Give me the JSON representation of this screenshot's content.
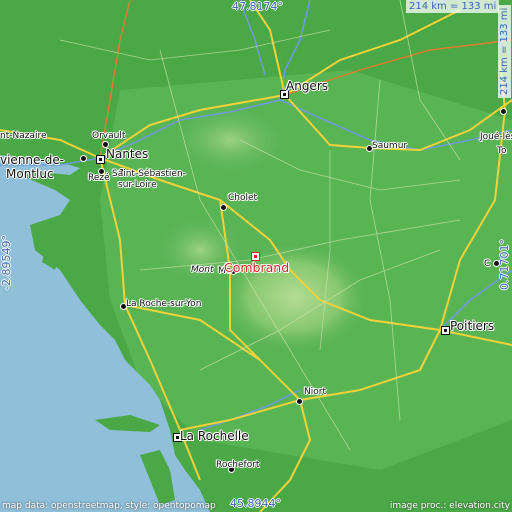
{
  "location": {
    "name": "Combrand"
  },
  "coordinates": {
    "top_lat": "47.8174°",
    "bottom_lat": "45.8944°",
    "left_lon": "-2.89549°",
    "right_lon": "0.71701°"
  },
  "scale": {
    "top": "214 km = 133 mi",
    "right": "214 km = 133 mi"
  },
  "credits": {
    "left": "map data: openstreetmap, style: opentopomap",
    "right": "image proc.: elevation.city"
  },
  "cities": {
    "angers": "Angers",
    "nantes": "Nantes",
    "orvault": "Orvault",
    "saint_nazaire": "nt-Nazaire",
    "montluc_top": "vienne-de-",
    "montluc_bottom": "Montluc",
    "reze": "Rezé",
    "st_sebastien_1": "Saint-Sébastien-",
    "st_sebastien_2": "sur-Loire",
    "saumur": "Saumur",
    "joue": "Joué-lès-",
    "tours_edge": "To",
    "cholet": "Cholet",
    "mont": "Mont",
    "mont_frag": "Mo",
    "la_roche": "La Roche-sur-Yon",
    "chatellerault_edge": "C",
    "poitiers": "Poitiers",
    "niort": "Niort",
    "la_rochelle": "La Rochelle",
    "rochefort": "Rochefort"
  },
  "colors": {
    "sea": "#8fbfd9",
    "land_low": "#3f9e3c",
    "land_mid": "#5fb85a",
    "land_high": "#a8d98a",
    "road": "#f2d23b",
    "river": "#6f9bd8",
    "marker": "#d9262b",
    "coord_text": "#3a63b8"
  }
}
